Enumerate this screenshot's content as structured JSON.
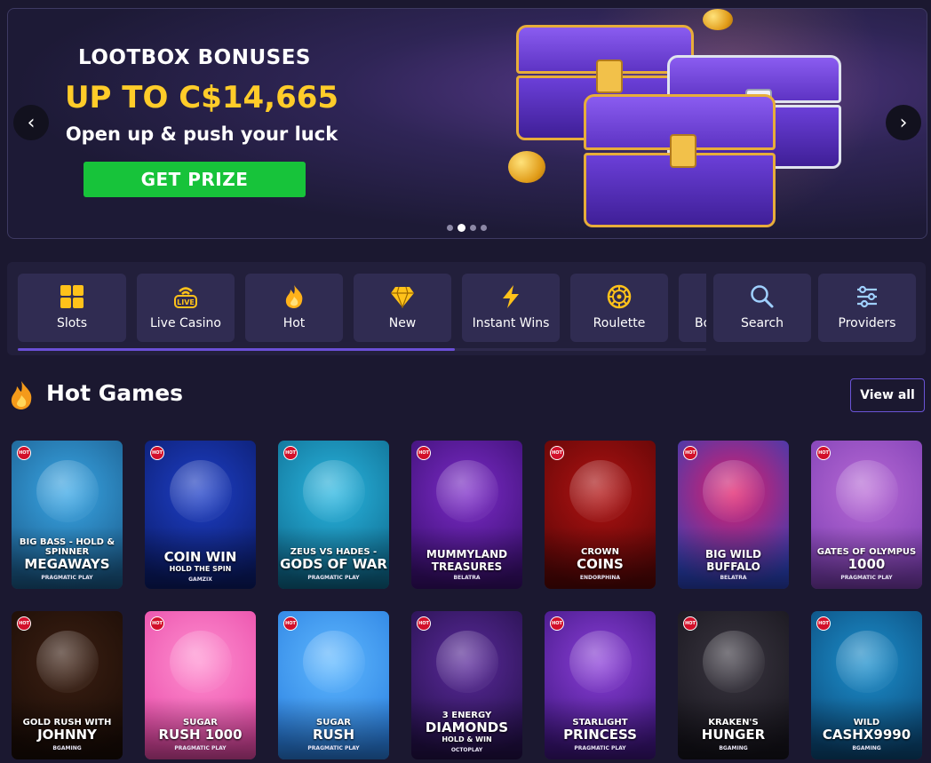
{
  "banner": {
    "title": "LOOTBOX BONUSES",
    "amount": "UP TO C$14,665",
    "subtitle": "Open up & push your luck",
    "cta": "GET PRIZE",
    "prev_icon": "chevron-left-icon",
    "next_icon": "chevron-right-icon",
    "slides_total": 4,
    "active_slide": 2,
    "colors": {
      "amount": "#ffcc29",
      "cta": "#17c33a"
    }
  },
  "categories": [
    {
      "label": "Slots",
      "icon": "slots-grid-icon"
    },
    {
      "label": "Live Casino",
      "icon": "live-icon"
    },
    {
      "label": "Hot",
      "icon": "flame-icon"
    },
    {
      "label": "New",
      "icon": "diamond-icon"
    },
    {
      "label": "Instant Wins",
      "icon": "lightning-icon"
    },
    {
      "label": "Roulette",
      "icon": "roulette-icon"
    },
    {
      "label": "Bo",
      "icon": ""
    }
  ],
  "tools": [
    {
      "label": "Search",
      "icon": "search-icon"
    },
    {
      "label": "Providers",
      "icon": "sliders-icon"
    }
  ],
  "hot_games": {
    "title": "Hot Games",
    "view_all": "View all",
    "badge": "HOT",
    "rows": [
      [
        {
          "line1": "BIG BASS - HOLD & SPINNER",
          "line2": "MEGAWAYS",
          "provider": "PRAGMATIC PLAY",
          "bg1": "#3aa7e6",
          "bg2": "#1b5c8c"
        },
        {
          "line1": "",
          "line2": "COIN WIN",
          "line3": "HOLD THE SPIN",
          "provider": "GAMZIX",
          "bg1": "#1e3fc7",
          "bg2": "#0b1c6b"
        },
        {
          "line1": "ZEUS VS HADES -",
          "line2": "GODS OF WAR",
          "provider": "PRAGMATIC PLAY",
          "bg1": "#2ab6e0",
          "bg2": "#0e6a8e"
        },
        {
          "line1": "",
          "line2": "MUMMYLAND TREASURES",
          "provider": "BELATRA",
          "bg1": "#7b2bc7",
          "bg2": "#3a0f70"
        },
        {
          "line1": "CROWN",
          "line2": "COINS",
          "provider": "ENDORPHINA",
          "bg1": "#b01212",
          "bg2": "#5a0606"
        },
        {
          "line1": "",
          "line2": "BIG WILD BUFFALO",
          "provider": "BELATRA",
          "bg1": "#e21d6a",
          "bg2": "#2a41b8"
        },
        {
          "line1": "GATES OF OLYMPUS",
          "line2": "1000",
          "provider": "PRAGMATIC PLAY",
          "bg1": "#b86ad6",
          "bg2": "#7d3fb3"
        }
      ],
      [
        {
          "line1": "GOLD RUSH WITH",
          "line2": "JOHNNY",
          "provider": "BGAMING",
          "bg1": "#3b1f12",
          "bg2": "#1a0c06"
        },
        {
          "line1": "SUGAR",
          "line2": "RUSH 1000",
          "provider": "PRAGMATIC PLAY",
          "bg1": "#ff8fd0",
          "bg2": "#e84aa8"
        },
        {
          "line1": "SUGAR",
          "line2": "RUSH",
          "provider": "PRAGMATIC PLAY",
          "bg1": "#5fb8ff",
          "bg2": "#2a7fe0"
        },
        {
          "line1": "3 ENERGY",
          "line2": "DIAMONDS",
          "line3": "HOLD & WIN",
          "provider": "OCTOPLAY",
          "bg1": "#5a2a9a",
          "bg2": "#24104a"
        },
        {
          "line1": "STARLIGHT",
          "line2": "PRINCESS",
          "provider": "PRAGMATIC PLAY",
          "bg1": "#8b3fd8",
          "bg2": "#3f1680"
        },
        {
          "line1": "KRAKEN'S",
          "line2": "HUNGER",
          "provider": "BGAMING",
          "bg1": "#3a3640",
          "bg2": "#16141c"
        },
        {
          "line1": "WILD",
          "line2": "CASHX9990",
          "provider": "BGAMING",
          "bg1": "#1d8fcc",
          "bg2": "#0b4a7a"
        }
      ]
    ]
  }
}
